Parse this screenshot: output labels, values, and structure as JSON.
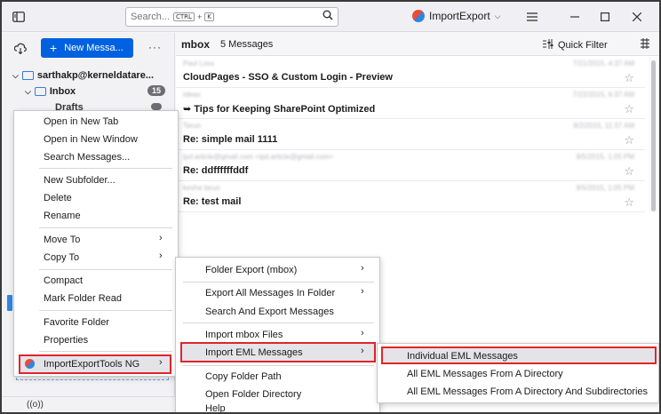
{
  "titlebar": {
    "search_placeholder": "Search...",
    "shortcut_ctrl": "CTRL",
    "shortcut_plus": "+",
    "shortcut_k": "K",
    "account_chip": "ImportExport"
  },
  "sidebar": {
    "new_message": "New Messa...",
    "account": "sarthakp@kerneldatare...",
    "inbox": "Inbox",
    "inbox_count": "15",
    "drafts": "Drafts",
    "bottom_status": "((o))"
  },
  "message_list": {
    "folder": "mbox",
    "count": "5 Messages",
    "quick_filter": "Quick Filter",
    "messages": [
      {
        "sender": "Paul Loss",
        "date": "7/21/2015, 4:37 AM",
        "subject": "CloudPages - SSO & Custom Login - Preview"
      },
      {
        "sender": "Ideas",
        "date": "7/22/2015, 6:37 AM",
        "subject": "➥ Tips for Keeping SharePoint Optimized"
      },
      {
        "sender": "Tarun",
        "date": "8/2/2015, 11:37 AM",
        "subject": "Re: simple mail 1111"
      },
      {
        "sender": "ipd.article@gmail.com <ipd.article@gmail.com>",
        "date": "8/5/2015, 1:05 PM",
        "subject": "Re: ddffffffddf"
      },
      {
        "sender": "kesha tarun",
        "date": "8/5/2015, 1:05 PM",
        "subject": "Re: test mail"
      }
    ]
  },
  "context_menu": {
    "items": [
      "Open in New Tab",
      "Open in New Window",
      "Search Messages...",
      "New Subfolder...",
      "Delete",
      "Rename",
      "Move To",
      "Copy To",
      "Compact",
      "Mark Folder Read",
      "Favorite Folder",
      "Properties",
      "ImportExportTools NG"
    ],
    "peek_text": "tarumina..."
  },
  "submenu": {
    "items": [
      "Folder Export (mbox)",
      "Export All Messages In Folder",
      "Search And Export Messages",
      "Import mbox Files",
      "Import EML Messages",
      "Copy Folder Path",
      "Open Folder Directory",
      "Help"
    ]
  },
  "eml_submenu": {
    "items": [
      "Individual EML Messages",
      "All EML Messages From A Directory",
      "All EML Messages From A Directory And Subdirectories"
    ]
  },
  "colors": {
    "accent": "#0061e0",
    "highlight_border": "#e0252b"
  }
}
